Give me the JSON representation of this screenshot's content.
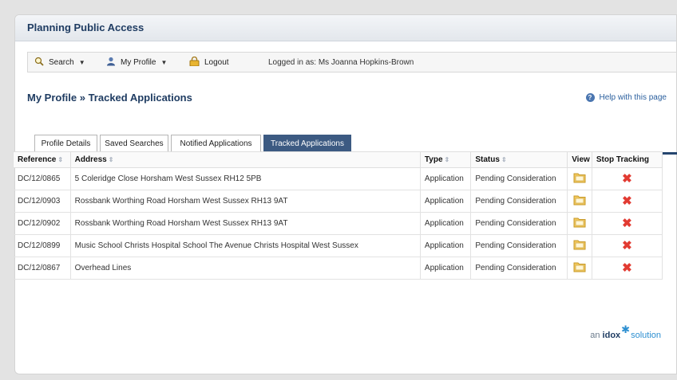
{
  "app": {
    "title": "Planning Public Access"
  },
  "toolbar": {
    "search_label": "Search",
    "profile_label": "My Profile",
    "logout_label": "Logout",
    "logged_in_text": "Logged in as: Ms Joanna Hopkins-Brown"
  },
  "page": {
    "heading": "My Profile » Tracked Applications",
    "help_label": "Help with this page"
  },
  "tabs": [
    {
      "label": "Profile Details",
      "active": false
    },
    {
      "label": "Saved Searches",
      "active": false
    },
    {
      "label": "Notified Applications",
      "active": false
    },
    {
      "label": "Tracked Applications",
      "active": true
    }
  ],
  "table": {
    "columns": [
      "Reference",
      "Address",
      "Type",
      "Status",
      "View",
      "Stop Tracking"
    ],
    "rows": [
      {
        "reference": "DC/12/0865",
        "address": "5 Coleridge Close Horsham West Sussex RH12 5PB",
        "type": "Application",
        "status": "Pending Consideration"
      },
      {
        "reference": "DC/12/0903",
        "address": "Rossbank Worthing Road Horsham West Sussex RH13 9AT",
        "type": "Application",
        "status": "Pending Consideration"
      },
      {
        "reference": "DC/12/0902",
        "address": "Rossbank Worthing Road Horsham West Sussex RH13 9AT",
        "type": "Application",
        "status": "Pending Consideration"
      },
      {
        "reference": "DC/12/0899",
        "address": "Music School Christs Hospital School The Avenue Christs Hospital West Sussex",
        "type": "Application",
        "status": "Pending Consideration"
      },
      {
        "reference": "DC/12/0867",
        "address": "Overhead Lines",
        "type": "Application",
        "status": "Pending Consideration"
      }
    ]
  },
  "footer": {
    "logo_prefix": "an",
    "logo_brand": "idox",
    "logo_suffix": "solution"
  },
  "colors": {
    "accent": "#25466f",
    "active_tab": "#3c5a82",
    "title": "#1f3c62",
    "stop_icon": "#e23b32"
  },
  "icons": {
    "search": "search-icon",
    "profile": "user-icon",
    "logout": "lock-icon",
    "help": "help-icon",
    "view": "folder-icon",
    "stop": "close-icon"
  }
}
